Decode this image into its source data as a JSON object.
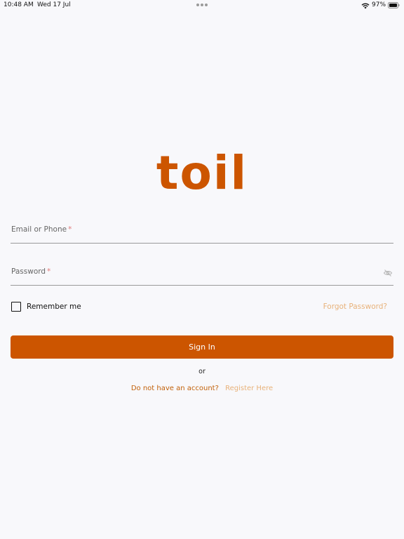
{
  "status_bar": {
    "time": "10:48 AM",
    "date": "Wed 17 Jul",
    "battery": "97%"
  },
  "logo": {
    "text": "toil",
    "color": "#cc5500"
  },
  "form": {
    "email_label": "Email or Phone",
    "password_label": "Password",
    "required_mark": "*",
    "remember_label": "Remember me",
    "remember_checked": false,
    "forgot_label": "Forgot Password?",
    "signin_label": "Sign In",
    "or_label": "or",
    "no_account_text": "Do not have an account?",
    "register_label": "Register Here"
  },
  "icons": {
    "password_toggle": "eye-off-icon",
    "wifi": "wifi-icon",
    "battery": "battery-icon"
  },
  "colors": {
    "accent": "#cc5500",
    "link": "#e8b27a",
    "required": "#e07a7a",
    "background": "#f8f8fb"
  }
}
